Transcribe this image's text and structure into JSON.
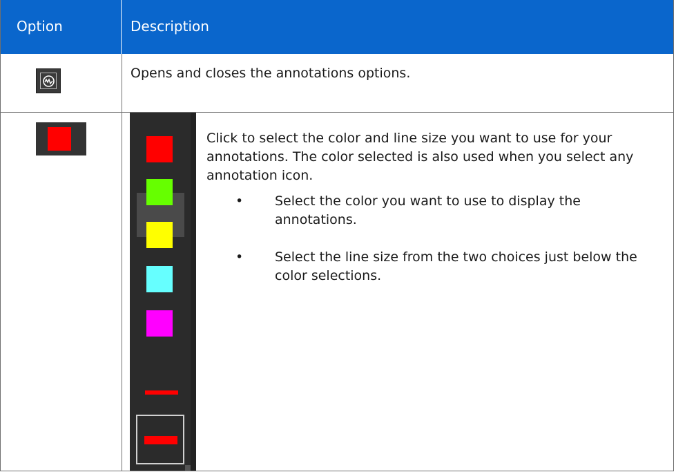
{
  "header": {
    "col1": "Option",
    "col2": "Description"
  },
  "rows": [
    {
      "icon": "annotations-toggle-icon",
      "description": "Opens and closes the annotations options."
    },
    {
      "icon": "color-swatch-icon",
      "description": "Click to select the color and line size you want to use for your annotations. The color selected is also used when you select any annotation icon.",
      "bullets": [
        "Select the color you want to use to display the annotations.",
        "Select the line size from the two choices just below the color selections."
      ]
    }
  ],
  "colors": {
    "header_bg": "#0a66cc",
    "selected_color": "#ff0000",
    "palette": [
      "#ff0000",
      "#66ff00",
      "#ffff00",
      "#66ffff",
      "#ff00ff"
    ]
  }
}
